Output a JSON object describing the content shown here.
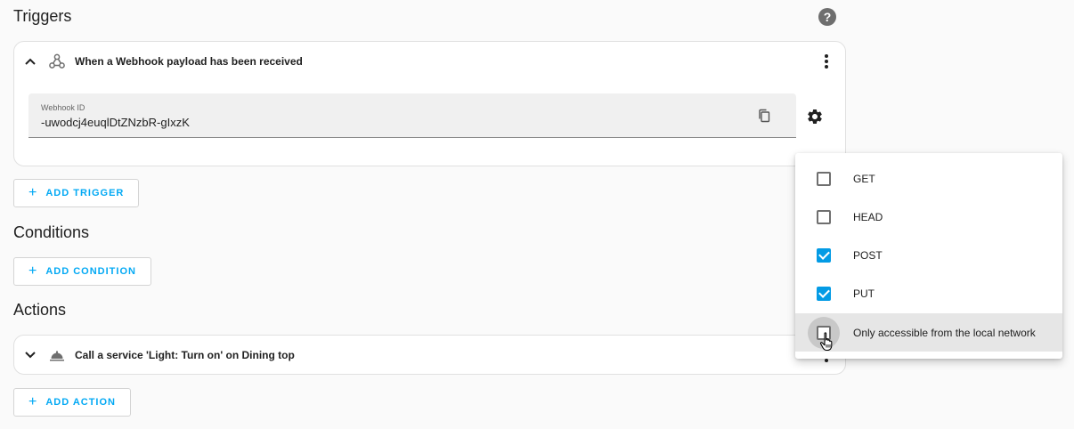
{
  "triggers": {
    "title": "Triggers",
    "help_icon": "help-circle-icon",
    "card": {
      "title": "When a Webhook payload has been received",
      "icon": "webhook-icon",
      "expanded": true,
      "webhook_field": {
        "label": "Webhook ID",
        "value": "-uwodcj4euqlDtZNzbR-gIxzK"
      }
    },
    "add_label": "ADD TRIGGER"
  },
  "conditions": {
    "title": "Conditions",
    "add_label": "ADD CONDITION"
  },
  "actions": {
    "title": "Actions",
    "card": {
      "title": "Call a service 'Light: Turn on' on Dining top",
      "icon": "service-bell-icon",
      "expanded": false
    },
    "add_label": "ADD ACTION"
  },
  "add_plus": "+",
  "webhook_menu": {
    "items": [
      {
        "label": "GET",
        "checked": false
      },
      {
        "label": "HEAD",
        "checked": false
      },
      {
        "label": "POST",
        "checked": true
      },
      {
        "label": "PUT",
        "checked": true
      },
      {
        "label": "Only accessible from the local network",
        "checked": false,
        "hovered": true
      }
    ]
  },
  "colors": {
    "accent": "#03a9f4",
    "checkbox_checked": "#039be5",
    "background": "#fafafa"
  }
}
